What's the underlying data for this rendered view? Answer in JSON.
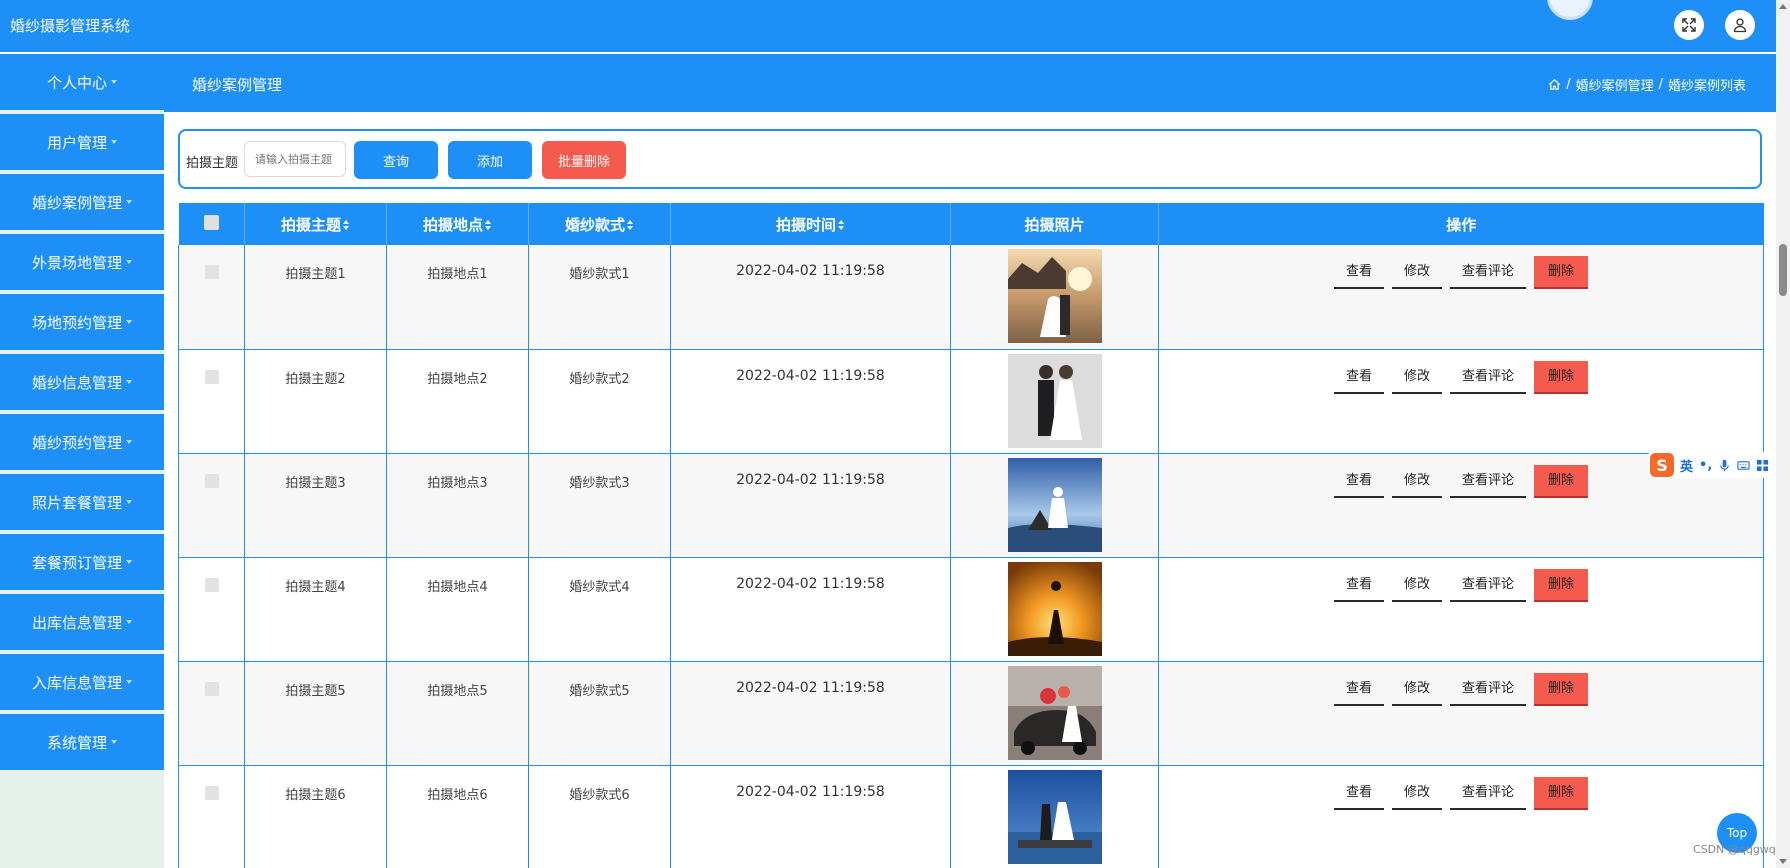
{
  "app": {
    "title": "婚纱摄影管理系统"
  },
  "topbar": {
    "expand_icon": "expand-icon",
    "user_icon": "user-icon"
  },
  "sidebar": {
    "items": [
      {
        "label": "个人中心"
      },
      {
        "label": "用户管理"
      },
      {
        "label": "婚纱案例管理"
      },
      {
        "label": "外景场地管理"
      },
      {
        "label": "场地预约管理"
      },
      {
        "label": "婚纱信息管理"
      },
      {
        "label": "婚纱预约管理"
      },
      {
        "label": "照片套餐管理"
      },
      {
        "label": "套餐预订管理"
      },
      {
        "label": "出库信息管理"
      },
      {
        "label": "入库信息管理"
      },
      {
        "label": "系统管理"
      }
    ]
  },
  "header": {
    "page_title": "婚纱案例管理",
    "breadcrumb": [
      {
        "label": "婚纱案例管理"
      },
      {
        "label": "婚纱案例列表"
      }
    ],
    "separator": "/"
  },
  "search": {
    "label": "拍摄主题",
    "placeholder": "请输入拍摄主题",
    "query_button": "查询",
    "add_button": "添加",
    "batch_delete_button": "批量删除"
  },
  "table": {
    "columns": {
      "theme": "拍摄主题",
      "location": "拍摄地点",
      "style": "婚纱款式",
      "time": "拍摄时间",
      "photo": "拍摄照片",
      "actions": "操作"
    },
    "actions": {
      "view": "查看",
      "edit": "修改",
      "comments": "查看评论",
      "delete": "删除"
    },
    "rows": [
      {
        "theme": "拍摄主题1",
        "location": "拍摄地点1",
        "style": "婚纱款式1",
        "time": "2022-04-02 11:19:58"
      },
      {
        "theme": "拍摄主题2",
        "location": "拍摄地点2",
        "style": "婚纱款式2",
        "time": "2022-04-02 11:19:58"
      },
      {
        "theme": "拍摄主题3",
        "location": "拍摄地点3",
        "style": "婚纱款式3",
        "time": "2022-04-02 11:19:58"
      },
      {
        "theme": "拍摄主题4",
        "location": "拍摄地点4",
        "style": "婚纱款式4",
        "time": "2022-04-02 11:19:58"
      },
      {
        "theme": "拍摄主题5",
        "location": "拍摄地点5",
        "style": "婚纱款式5",
        "time": "2022-04-02 11:19:58"
      },
      {
        "theme": "拍摄主题6",
        "location": "拍摄地点6",
        "style": "婚纱款式6",
        "time": "2022-04-02 11:19:58"
      }
    ]
  },
  "ime": {
    "lang": "英",
    "punct": "•,"
  },
  "top_button": "Top",
  "watermark": "CSDN @qqgwqd",
  "colors": {
    "primary": "#1e8ff7",
    "danger": "#f55a4e",
    "sidebar_bg": "#e6f1ec"
  }
}
